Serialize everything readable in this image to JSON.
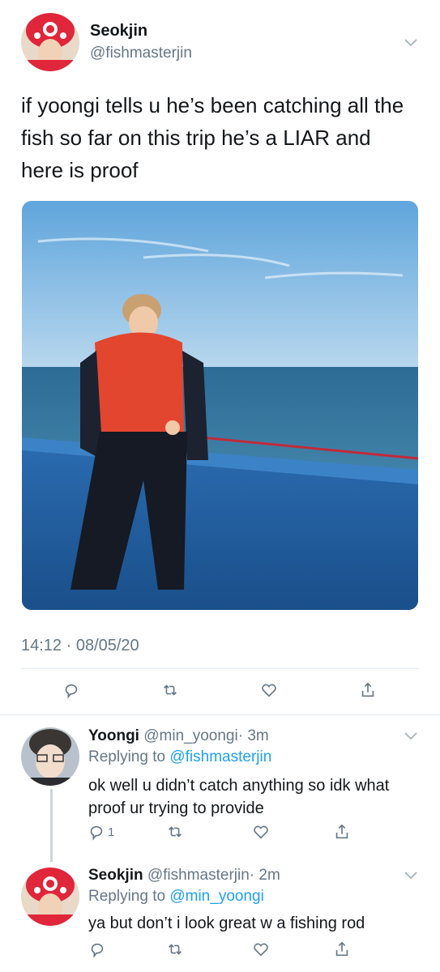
{
  "main_tweet": {
    "display_name": "Seokjin",
    "handle": "@fishmasterjin",
    "text": "if yoongi tells u he’s been catching all the fish so far on this trip he’s a LIAR and here is proof",
    "timestamp": "14:12 · 08/05/20"
  },
  "replies": [
    {
      "display_name": "Yoongi",
      "handle": "@min_yoongi",
      "age": "· 3m",
      "replying_label": "Replying to",
      "replying_to": "@fishmasterjin",
      "text": "ok well u didn’t catch anything so idk what proof ur trying to provide",
      "reply_count": "1"
    },
    {
      "display_name": "Seokjin",
      "handle": "@fishmasterjin",
      "age": "· 2m",
      "replying_label": "Replying to",
      "replying_to": "@min_yoongi",
      "text": "ya but don’t i look great w a fishing rod",
      "reply_count": ""
    }
  ],
  "icons": [
    "chevron-down-icon",
    "reply-icon",
    "retweet-icon",
    "like-icon",
    "share-icon"
  ],
  "colors": {
    "accent": "#1da1f2",
    "muted": "#657786",
    "text": "#14171a",
    "divider": "#e1e8ed"
  }
}
